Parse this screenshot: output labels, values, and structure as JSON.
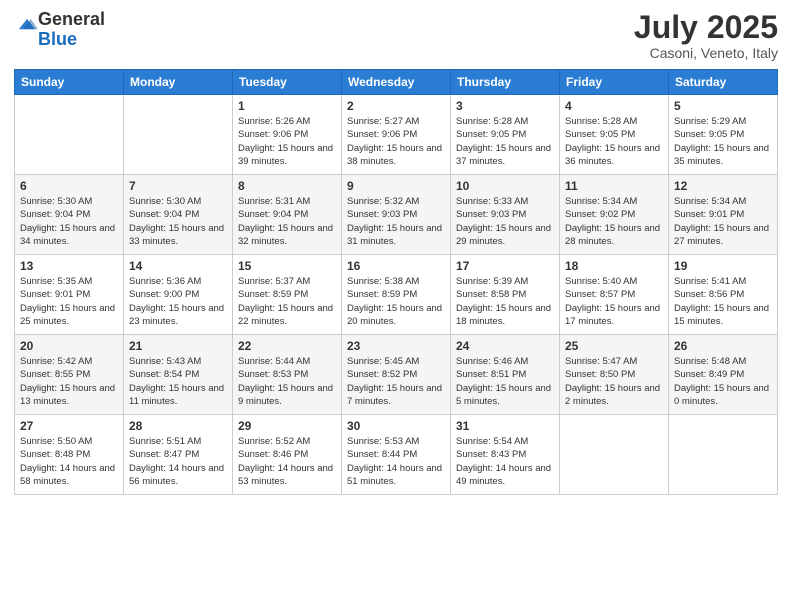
{
  "header": {
    "logo_general": "General",
    "logo_blue": "Blue",
    "title": "July 2025",
    "location": "Casoni, Veneto, Italy"
  },
  "weekdays": [
    "Sunday",
    "Monday",
    "Tuesday",
    "Wednesday",
    "Thursday",
    "Friday",
    "Saturday"
  ],
  "weeks": [
    [
      {
        "day": "",
        "info": ""
      },
      {
        "day": "",
        "info": ""
      },
      {
        "day": "1",
        "info": "Sunrise: 5:26 AM\nSunset: 9:06 PM\nDaylight: 15 hours and 39 minutes."
      },
      {
        "day": "2",
        "info": "Sunrise: 5:27 AM\nSunset: 9:06 PM\nDaylight: 15 hours and 38 minutes."
      },
      {
        "day": "3",
        "info": "Sunrise: 5:28 AM\nSunset: 9:05 PM\nDaylight: 15 hours and 37 minutes."
      },
      {
        "day": "4",
        "info": "Sunrise: 5:28 AM\nSunset: 9:05 PM\nDaylight: 15 hours and 36 minutes."
      },
      {
        "day": "5",
        "info": "Sunrise: 5:29 AM\nSunset: 9:05 PM\nDaylight: 15 hours and 35 minutes."
      }
    ],
    [
      {
        "day": "6",
        "info": "Sunrise: 5:30 AM\nSunset: 9:04 PM\nDaylight: 15 hours and 34 minutes."
      },
      {
        "day": "7",
        "info": "Sunrise: 5:30 AM\nSunset: 9:04 PM\nDaylight: 15 hours and 33 minutes."
      },
      {
        "day": "8",
        "info": "Sunrise: 5:31 AM\nSunset: 9:04 PM\nDaylight: 15 hours and 32 minutes."
      },
      {
        "day": "9",
        "info": "Sunrise: 5:32 AM\nSunset: 9:03 PM\nDaylight: 15 hours and 31 minutes."
      },
      {
        "day": "10",
        "info": "Sunrise: 5:33 AM\nSunset: 9:03 PM\nDaylight: 15 hours and 29 minutes."
      },
      {
        "day": "11",
        "info": "Sunrise: 5:34 AM\nSunset: 9:02 PM\nDaylight: 15 hours and 28 minutes."
      },
      {
        "day": "12",
        "info": "Sunrise: 5:34 AM\nSunset: 9:01 PM\nDaylight: 15 hours and 27 minutes."
      }
    ],
    [
      {
        "day": "13",
        "info": "Sunrise: 5:35 AM\nSunset: 9:01 PM\nDaylight: 15 hours and 25 minutes."
      },
      {
        "day": "14",
        "info": "Sunrise: 5:36 AM\nSunset: 9:00 PM\nDaylight: 15 hours and 23 minutes."
      },
      {
        "day": "15",
        "info": "Sunrise: 5:37 AM\nSunset: 8:59 PM\nDaylight: 15 hours and 22 minutes."
      },
      {
        "day": "16",
        "info": "Sunrise: 5:38 AM\nSunset: 8:59 PM\nDaylight: 15 hours and 20 minutes."
      },
      {
        "day": "17",
        "info": "Sunrise: 5:39 AM\nSunset: 8:58 PM\nDaylight: 15 hours and 18 minutes."
      },
      {
        "day": "18",
        "info": "Sunrise: 5:40 AM\nSunset: 8:57 PM\nDaylight: 15 hours and 17 minutes."
      },
      {
        "day": "19",
        "info": "Sunrise: 5:41 AM\nSunset: 8:56 PM\nDaylight: 15 hours and 15 minutes."
      }
    ],
    [
      {
        "day": "20",
        "info": "Sunrise: 5:42 AM\nSunset: 8:55 PM\nDaylight: 15 hours and 13 minutes."
      },
      {
        "day": "21",
        "info": "Sunrise: 5:43 AM\nSunset: 8:54 PM\nDaylight: 15 hours and 11 minutes."
      },
      {
        "day": "22",
        "info": "Sunrise: 5:44 AM\nSunset: 8:53 PM\nDaylight: 15 hours and 9 minutes."
      },
      {
        "day": "23",
        "info": "Sunrise: 5:45 AM\nSunset: 8:52 PM\nDaylight: 15 hours and 7 minutes."
      },
      {
        "day": "24",
        "info": "Sunrise: 5:46 AM\nSunset: 8:51 PM\nDaylight: 15 hours and 5 minutes."
      },
      {
        "day": "25",
        "info": "Sunrise: 5:47 AM\nSunset: 8:50 PM\nDaylight: 15 hours and 2 minutes."
      },
      {
        "day": "26",
        "info": "Sunrise: 5:48 AM\nSunset: 8:49 PM\nDaylight: 15 hours and 0 minutes."
      }
    ],
    [
      {
        "day": "27",
        "info": "Sunrise: 5:50 AM\nSunset: 8:48 PM\nDaylight: 14 hours and 58 minutes."
      },
      {
        "day": "28",
        "info": "Sunrise: 5:51 AM\nSunset: 8:47 PM\nDaylight: 14 hours and 56 minutes."
      },
      {
        "day": "29",
        "info": "Sunrise: 5:52 AM\nSunset: 8:46 PM\nDaylight: 14 hours and 53 minutes."
      },
      {
        "day": "30",
        "info": "Sunrise: 5:53 AM\nSunset: 8:44 PM\nDaylight: 14 hours and 51 minutes."
      },
      {
        "day": "31",
        "info": "Sunrise: 5:54 AM\nSunset: 8:43 PM\nDaylight: 14 hours and 49 minutes."
      },
      {
        "day": "",
        "info": ""
      },
      {
        "day": "",
        "info": ""
      }
    ]
  ]
}
